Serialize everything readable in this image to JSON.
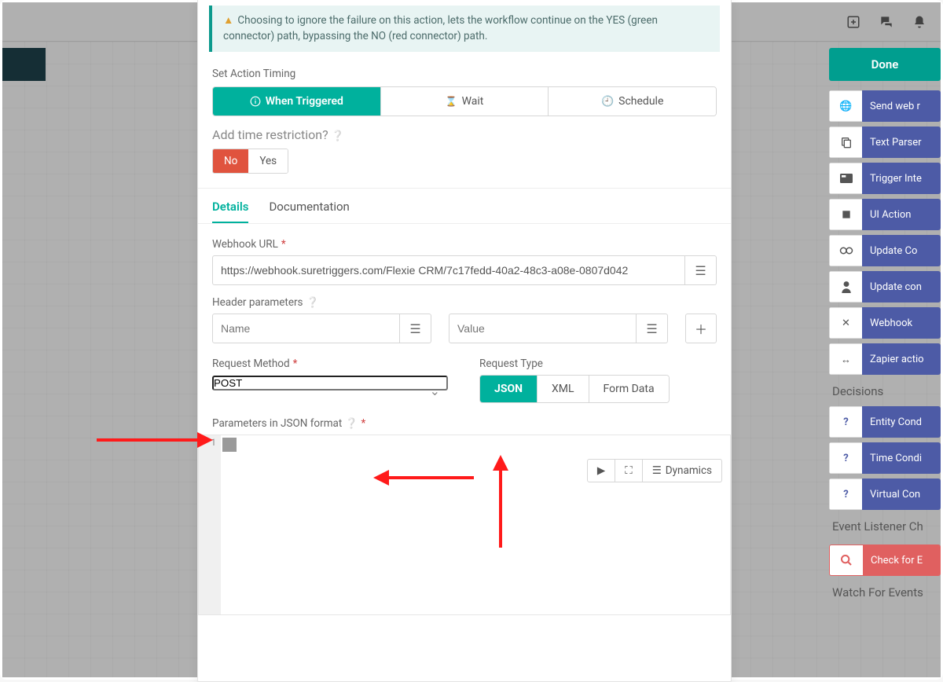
{
  "info_message": "Choosing to ignore the failure on this action, lets the workflow continue on the YES (green connector) path, bypassing the NO (red connector) path.",
  "timing": {
    "label": "Set Action Timing",
    "when_triggered": "When Triggered",
    "wait": "Wait",
    "schedule": "Schedule",
    "restrict_q": "Add time restriction?",
    "no": "No",
    "yes": "Yes"
  },
  "tabs": {
    "details": "Details",
    "docs": "Documentation"
  },
  "details": {
    "webhook_label": "Webhook URL",
    "webhook_value": "https://webhook.suretriggers.com/Flexie CRM/7c17fedd-40a2-48c3-a08e-0807d042",
    "header_params_label": "Header parameters",
    "hp_name_ph": "Name",
    "hp_value_ph": "Value",
    "request_method_label": "Request Method",
    "request_method_value": "POST",
    "request_type_label": "Request Type",
    "rt_json": "JSON",
    "rt_xml": "XML",
    "rt_form": "Form Data",
    "params_json_label": "Parameters in JSON format",
    "dynamics_btn": "Dynamics",
    "line_number": "1"
  },
  "right": {
    "done": "Done",
    "decisions_title": "Decisions",
    "event_listener_title": "Event Listener Ch",
    "watch_title": "Watch For Events",
    "actions": [
      {
        "icon": "globe",
        "label": "Send web r"
      },
      {
        "icon": "copy",
        "label": "Text Parser"
      },
      {
        "icon": "card",
        "label": "Trigger Inte"
      },
      {
        "icon": "square",
        "label": "UI Action"
      },
      {
        "icon": "gears",
        "label": "Update Co"
      },
      {
        "icon": "user",
        "label": "Update con"
      },
      {
        "icon": "shuffle",
        "label": "Webhook"
      },
      {
        "icon": "harr",
        "label": "Zapier actio"
      }
    ],
    "decisions": [
      {
        "label": "Entity Cond"
      },
      {
        "label": "Time Condi"
      },
      {
        "label": "Virtual Con"
      }
    ],
    "check": "Check for E"
  }
}
